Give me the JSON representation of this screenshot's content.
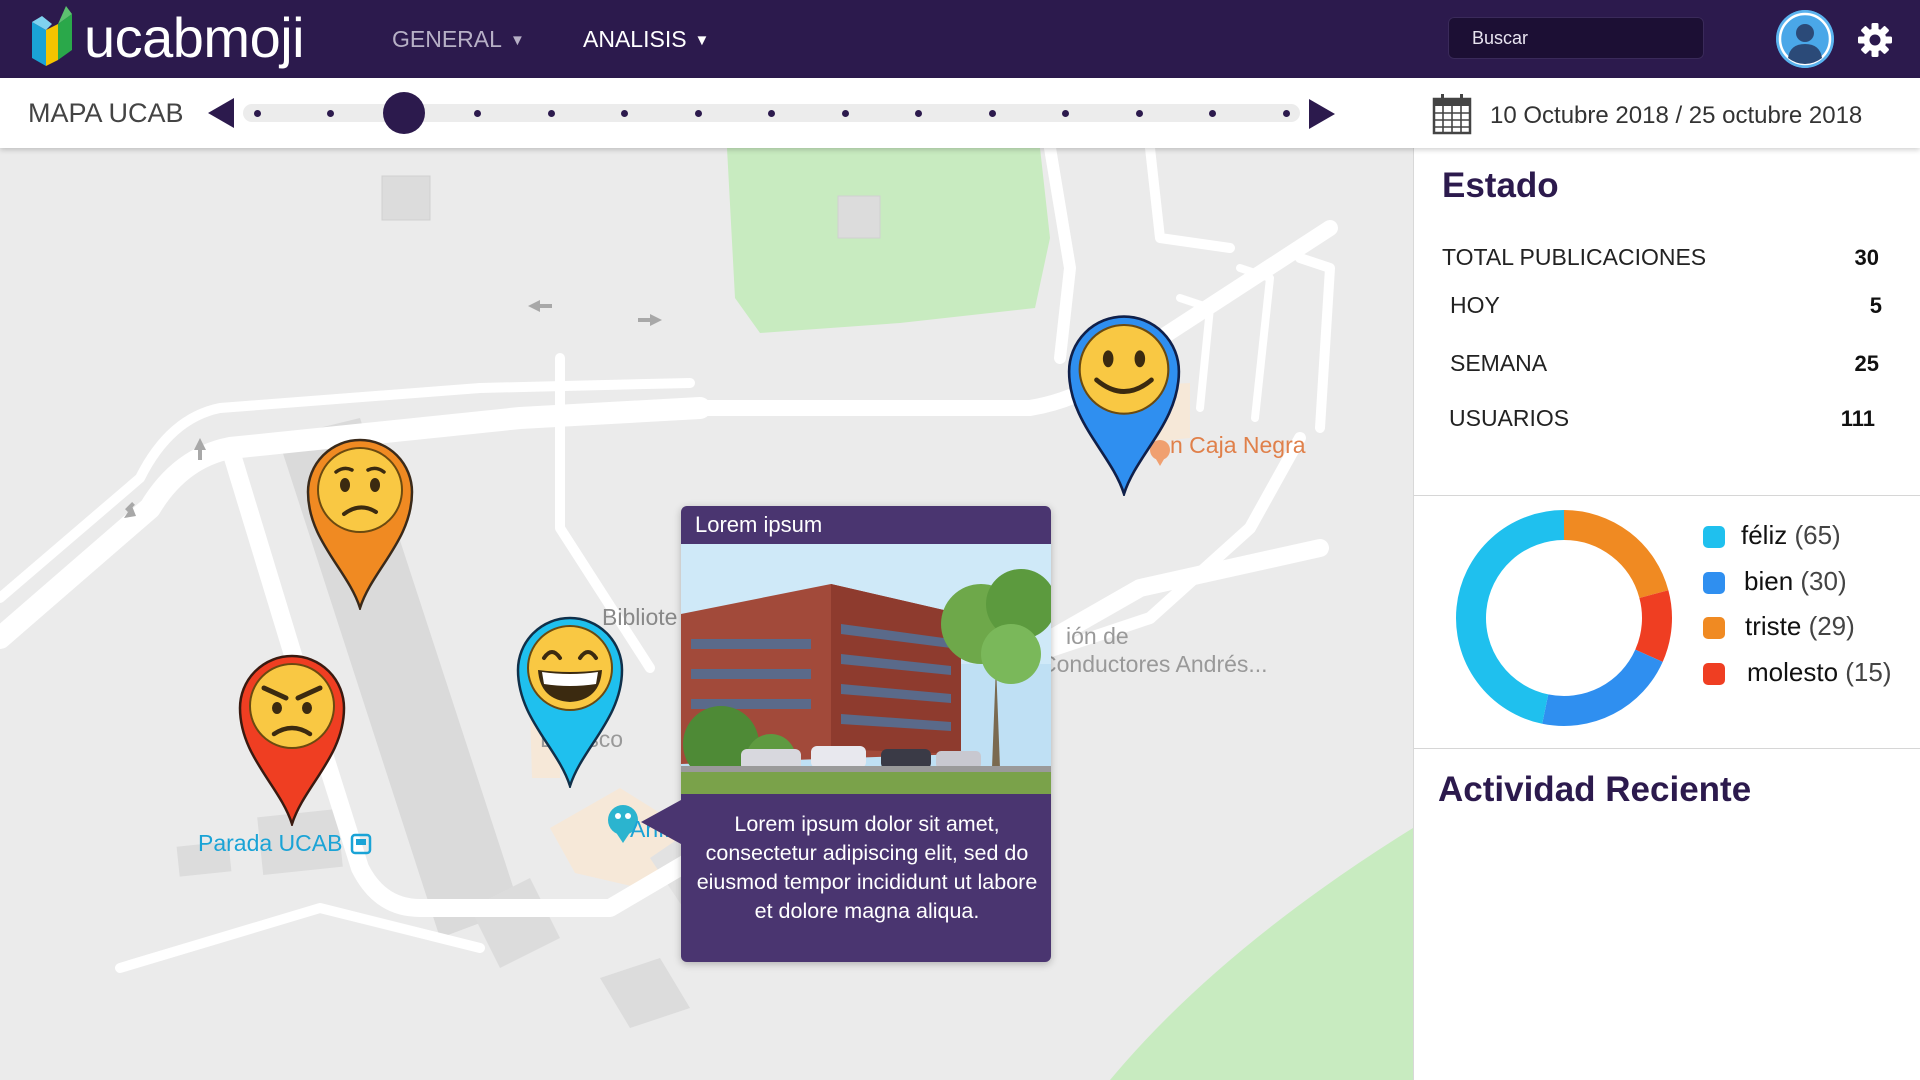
{
  "header": {
    "brand": "ucabmoji",
    "nav": [
      {
        "label": "GENERAL"
      },
      {
        "label": "ANALISIS"
      }
    ],
    "search_placeholder": "Buscar"
  },
  "timeline": {
    "label": "MAPA UCAB",
    "date_range": "10 Octubre 2018 / 25 octubre 2018",
    "steps": 15,
    "selected_step": 3
  },
  "map": {
    "pois": {
      "parada": "Parada UCAB",
      "anfiteatro": "Anfiteatro",
      "caja_negra": "n Caja Negra",
      "biblioteca": "Bibliote",
      "conductores_1": "ión de",
      "conductores_2": "Conductores Andrés...",
      "bsco": "B     sco"
    },
    "pins": [
      {
        "mood": "triste",
        "color": "#f08a22"
      },
      {
        "mood": "molesto",
        "color": "#ef3e22"
      },
      {
        "mood": "féliz",
        "color": "#1fc0ee"
      },
      {
        "mood": "bien",
        "color": "#2f8ff0"
      }
    ],
    "popup": {
      "title": "Lorem ipsum",
      "body": "Lorem ipsum dolor sit amet, consectetur adipiscing elit, sed do eiusmod tempor incididunt ut labore et dolore magna aliqua."
    }
  },
  "panel": {
    "estado_title": "Estado",
    "stats": [
      {
        "label": "TOTAL PUBLICACIONES",
        "value": "30"
      },
      {
        "label": "HOY",
        "value": "5"
      },
      {
        "label": "SEMANA",
        "value": "25"
      },
      {
        "label": "USUARIOS",
        "value": "111"
      }
    ],
    "actividad_title": "Actividad Reciente"
  },
  "chart_data": {
    "type": "pie",
    "categories": [
      "féliz",
      "bien",
      "triste",
      "molesto"
    ],
    "values": [
      65,
      30,
      29,
      15
    ],
    "colors": [
      "#1fc0ee",
      "#2f8ff0",
      "#f08a22",
      "#ef3e22"
    ],
    "legend": "right"
  }
}
